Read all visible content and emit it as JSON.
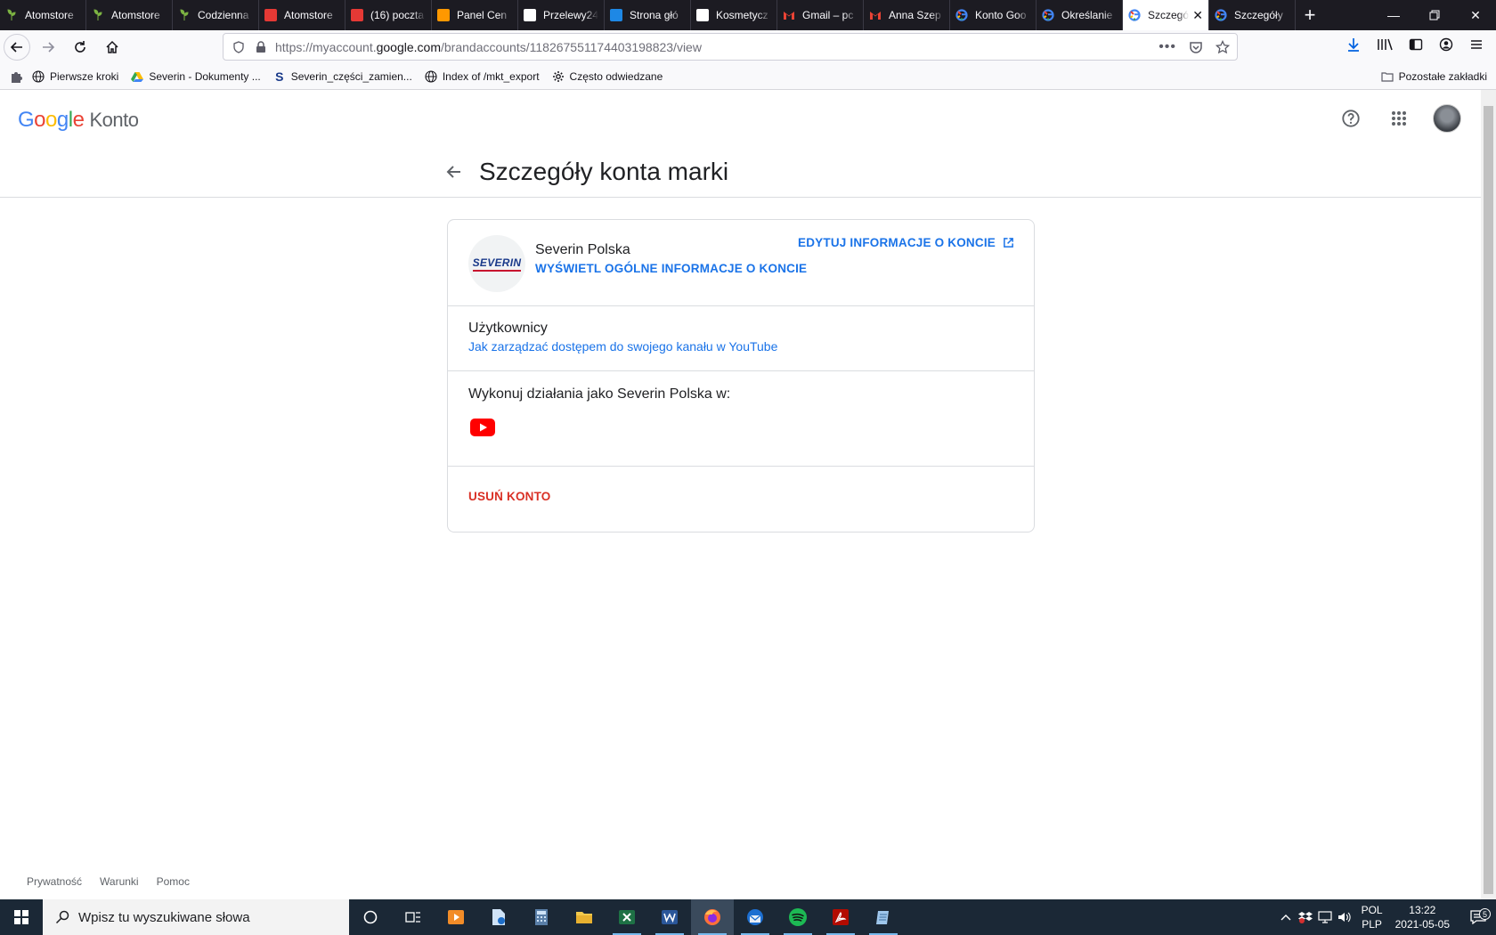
{
  "browser": {
    "tabs": [
      {
        "title": "Atomstore",
        "icon": "leaf-icon",
        "color": "#4caf50"
      },
      {
        "title": "Atomstore",
        "icon": "leaf-icon",
        "color": "#4caf50"
      },
      {
        "title": "Codzienna",
        "icon": "leaf-icon",
        "color": "#4caf50"
      },
      {
        "title": "Atomstore",
        "icon": "atom-icon",
        "color": "#e53935"
      },
      {
        "title": "(16) poczta",
        "icon": "mail-cloud-icon",
        "color": "#e53935"
      },
      {
        "title": "Panel Cen",
        "icon": "panel-icon",
        "color": "#ff9800"
      },
      {
        "title": "Przelewy24",
        "icon": "transfer-icon",
        "color": "#ffffff"
      },
      {
        "title": "Strona głó",
        "icon": "paypal-icon",
        "color": "#1e88e5"
      },
      {
        "title": "Kosmetycz",
        "icon": "cosmetics-icon",
        "color": "#ffffff"
      },
      {
        "title": "Gmail – pc",
        "icon": "gmail-icon",
        "color": "#ea4335"
      },
      {
        "title": "Anna Szep",
        "icon": "gmail-icon",
        "color": "#ea4335"
      },
      {
        "title": "Konto Goo",
        "icon": "google-icon",
        "color": "#4285f4"
      },
      {
        "title": "Określanie",
        "icon": "google-icon",
        "color": "#4285f4"
      },
      {
        "title": "Szczegóły",
        "icon": "google-icon",
        "color": "#4285f4",
        "active": true
      },
      {
        "title": "Szczegóły",
        "icon": "google-icon",
        "color": "#4285f4"
      }
    ],
    "url_prefix": "https://myaccount.",
    "url_domain": "google.com",
    "url_path": "/brandaccounts/118267551174403198823/view",
    "bookmarks": [
      {
        "label": "Pierwsze kroki",
        "icon": "globe-icon"
      },
      {
        "label": "Severin - Dokumenty ...",
        "icon": "drive-icon"
      },
      {
        "label": "Severin_części_zamien...",
        "icon": "severin-s-icon"
      },
      {
        "label": "Index of /mkt_export",
        "icon": "globe-icon"
      },
      {
        "label": "Często odwiedzane",
        "icon": "gear-icon"
      }
    ],
    "other_bookmarks": "Pozostałe zakładki"
  },
  "header": {
    "logo_google": "Google",
    "logo_konto": "Konto"
  },
  "page": {
    "title": "Szczegóły konta marki",
    "brand_name": "Severin Polska",
    "brand_logo_text": "SEVERIN",
    "view_info_link": "WYŚWIETL OGÓLNE INFORMACJE O KONCIE",
    "edit_info_link": "EDYTUJ INFORMACJE O KONCIE",
    "users_heading": "Użytkownicy",
    "users_link": "Jak zarządzać dostępem do swojego kanału w YouTube",
    "act_as_heading": "Wykonuj działania jako Severin Polska w:",
    "delete_link": "USUŃ KONTO"
  },
  "footer": {
    "privacy": "Prywatność",
    "terms": "Warunki",
    "help": "Pomoc"
  },
  "taskbar": {
    "search_placeholder": "Wpisz tu wyszukiwane słowa",
    "lang_top": "POL",
    "lang_bottom": "PLP",
    "time": "13:22",
    "date": "2021-05-05",
    "notification_count": "5"
  }
}
